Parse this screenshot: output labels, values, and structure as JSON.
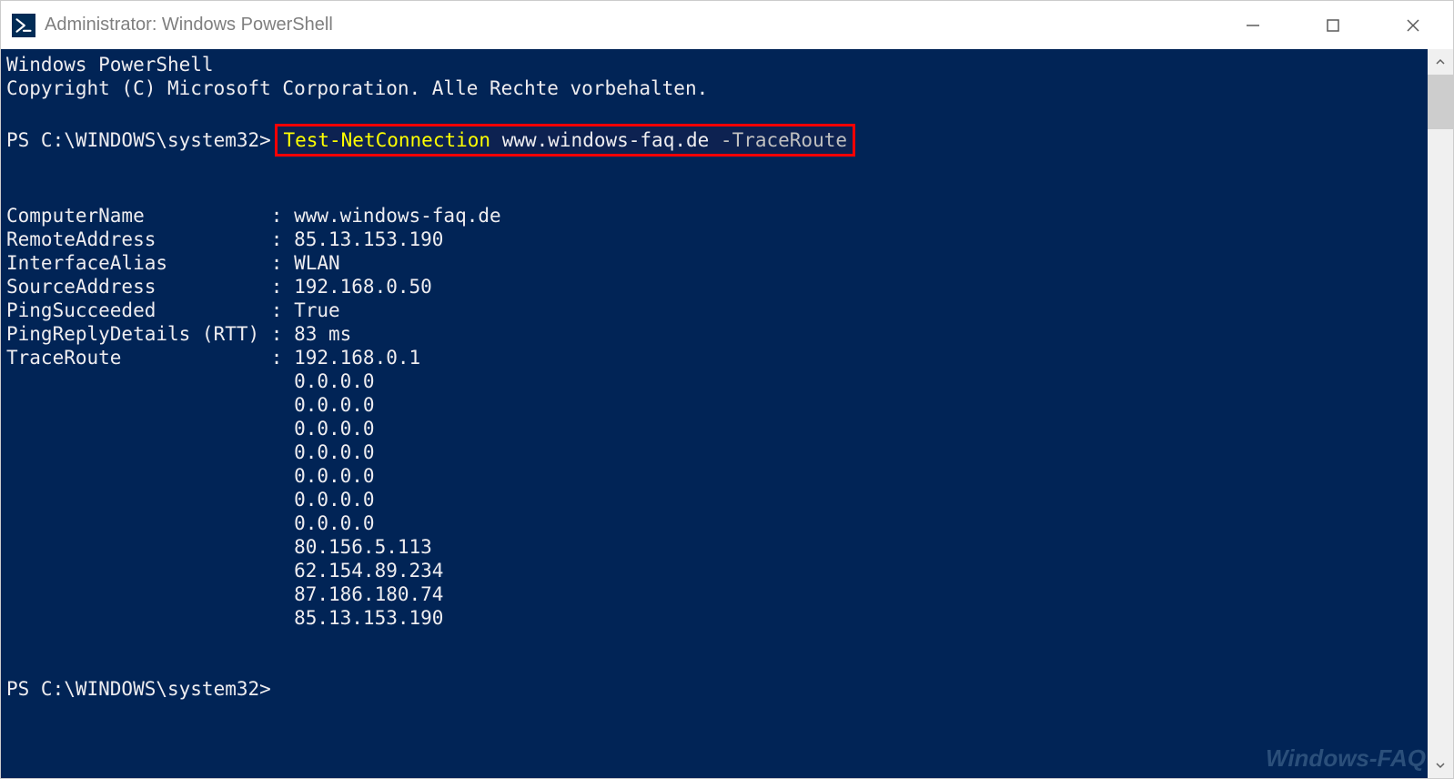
{
  "window": {
    "title": "Administrator: Windows PowerShell"
  },
  "banner": {
    "line1": "Windows PowerShell",
    "line2": "Copyright (C) Microsoft Corporation. Alle Rechte vorbehalten."
  },
  "prompt1": {
    "path": "PS C:\\WINDOWS\\system32>",
    "cmd_name": "Test-NetConnection",
    "cmd_arg": "www.windows-faq.de",
    "cmd_flag": "-TraceRoute"
  },
  "output": {
    "rows": [
      {
        "key": "ComputerName",
        "val": "www.windows-faq.de"
      },
      {
        "key": "RemoteAddress",
        "val": "85.13.153.190"
      },
      {
        "key": "InterfaceAlias",
        "val": "WLAN"
      },
      {
        "key": "SourceAddress",
        "val": "192.168.0.50"
      },
      {
        "key": "PingSucceeded",
        "val": "True"
      },
      {
        "key": "PingReplyDetails (RTT)",
        "val": "83 ms"
      },
      {
        "key": "TraceRoute",
        "val": "192.168.0.1"
      }
    ],
    "trace_extra": [
      "0.0.0.0",
      "0.0.0.0",
      "0.0.0.0",
      "0.0.0.0",
      "0.0.0.0",
      "0.0.0.0",
      "0.0.0.0",
      "80.156.5.113",
      "62.154.89.234",
      "87.186.180.74",
      "85.13.153.190"
    ]
  },
  "prompt2": {
    "path": "PS C:\\WINDOWS\\system32>"
  },
  "watermark": "Windows-FAQ"
}
